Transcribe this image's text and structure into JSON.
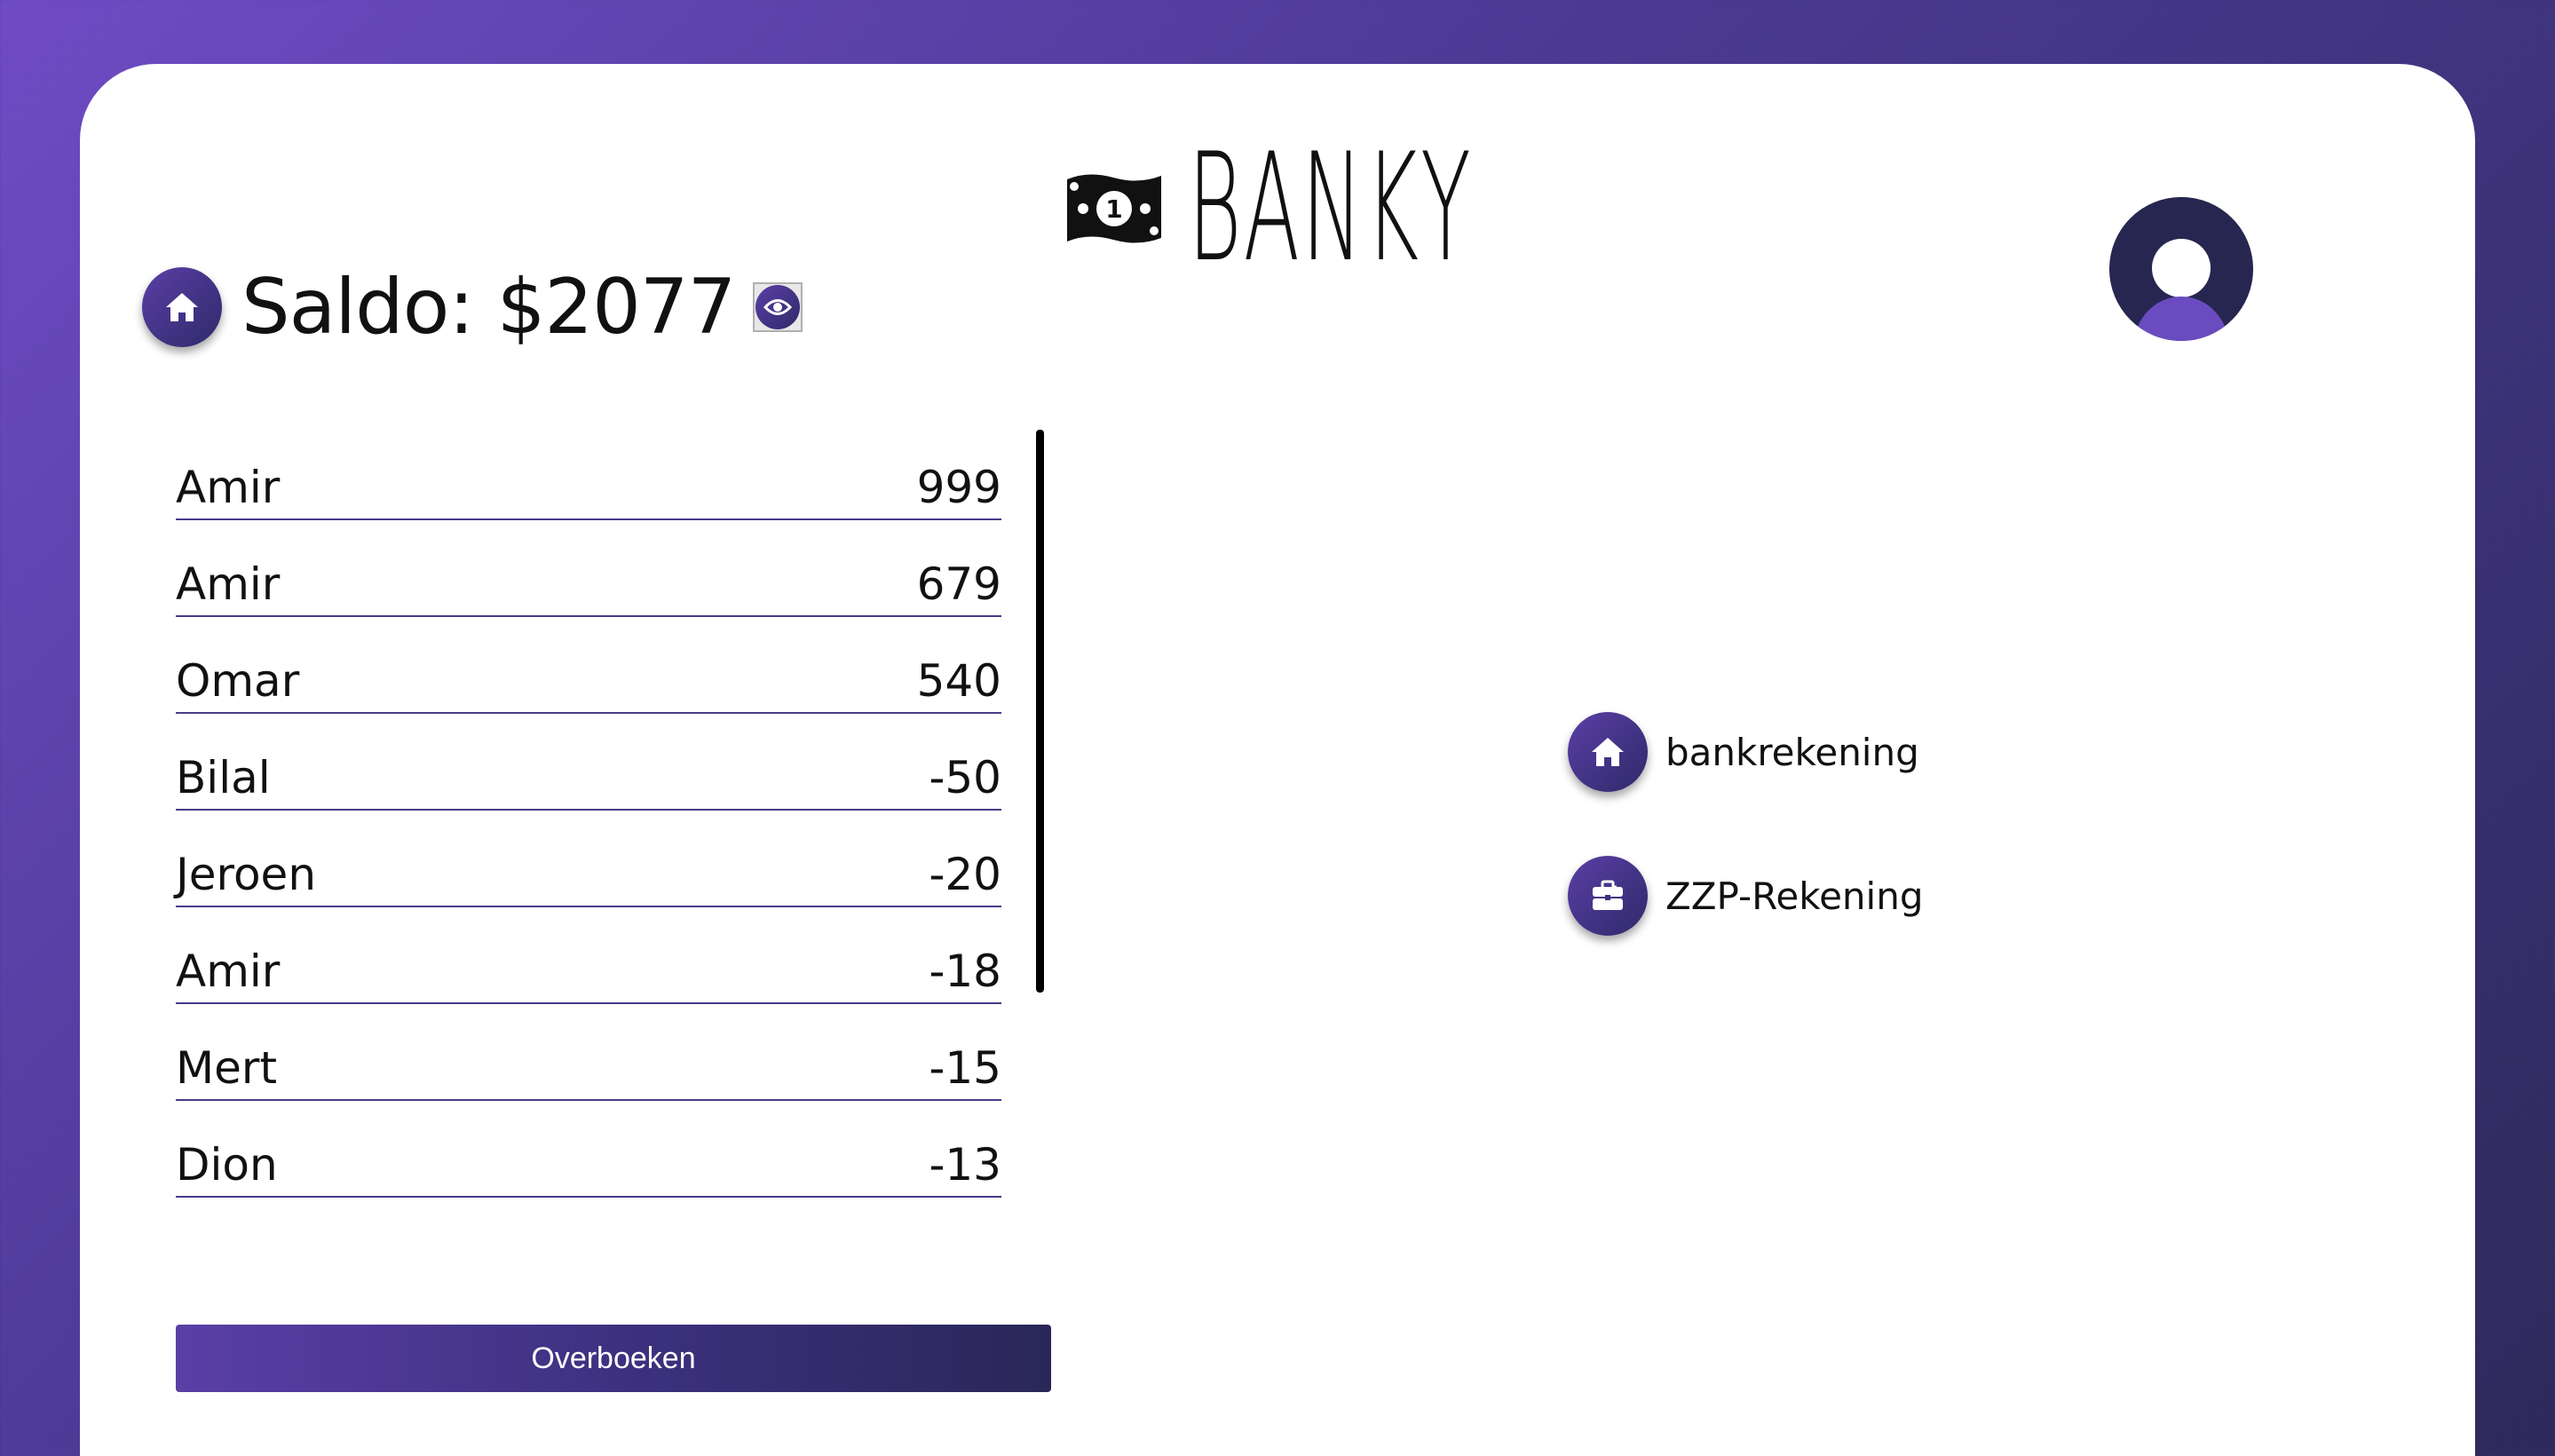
{
  "app": {
    "logo_text": "BANKY"
  },
  "balance": {
    "label": "Saldo: $2077"
  },
  "transactions": [
    {
      "name": "Amir",
      "amount": "999"
    },
    {
      "name": "Amir",
      "amount": "679"
    },
    {
      "name": "Omar",
      "amount": "540"
    },
    {
      "name": "Bilal",
      "amount": "-50"
    },
    {
      "name": "Jeroen",
      "amount": "-20"
    },
    {
      "name": "Amir",
      "amount": "-18"
    },
    {
      "name": "Mert",
      "amount": "-15"
    },
    {
      "name": "Dion",
      "amount": "-13"
    }
  ],
  "actions": {
    "transfer_label": "Overboeken"
  },
  "accounts": [
    {
      "label": "bankrekening",
      "icon": "home-icon"
    },
    {
      "label": "ZZP-Rekening",
      "icon": "briefcase-icon"
    }
  ],
  "colors": {
    "accent": "#4b3a94",
    "accent_light": "#6f4bc4",
    "accent_dark": "#2e2a5c"
  }
}
